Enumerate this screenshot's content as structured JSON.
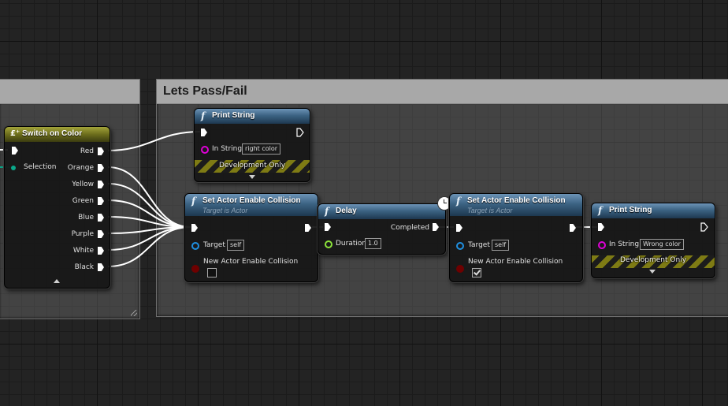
{
  "comments": {
    "left": {
      "title": ""
    },
    "main": {
      "title": "Lets Pass/Fail"
    }
  },
  "switch_node": {
    "title": "Switch on Color",
    "input_label": "Selection",
    "outputs": [
      "Red",
      "Orange",
      "Yellow",
      "Green",
      "Blue",
      "Purple",
      "White",
      "Black"
    ]
  },
  "print_top": {
    "title": "Print String",
    "in_string_label": "In String",
    "in_string_value": "right color",
    "dev_only": "Development Only"
  },
  "collision_1": {
    "title": "Set Actor Enable Collision",
    "subtitle": "Target is Actor",
    "target_label": "Target",
    "target_value": "self",
    "param_label": "New Actor Enable Collision",
    "param_checked": false
  },
  "delay": {
    "title": "Delay",
    "completed_label": "Completed",
    "duration_label": "Duration",
    "duration_value": "1.0"
  },
  "collision_2": {
    "title": "Set Actor Enable Collision",
    "subtitle": "Target is Actor",
    "target_label": "Target",
    "target_value": "self",
    "param_label": "New Actor Enable Collision",
    "param_checked": true
  },
  "print_right": {
    "title": "Print String",
    "in_string_label": "In String",
    "in_string_value": "Wrong color",
    "dev_only": "Development Only"
  },
  "colors": {
    "function_header": "#3c6383",
    "switch_header": "#6c6d1c",
    "exec_wire": "#ffffff",
    "object_pin": "#1f8fe0",
    "string_pin": "#e000d8",
    "float_pin": "#8ce33a",
    "bool_pin": "#6e0000"
  }
}
